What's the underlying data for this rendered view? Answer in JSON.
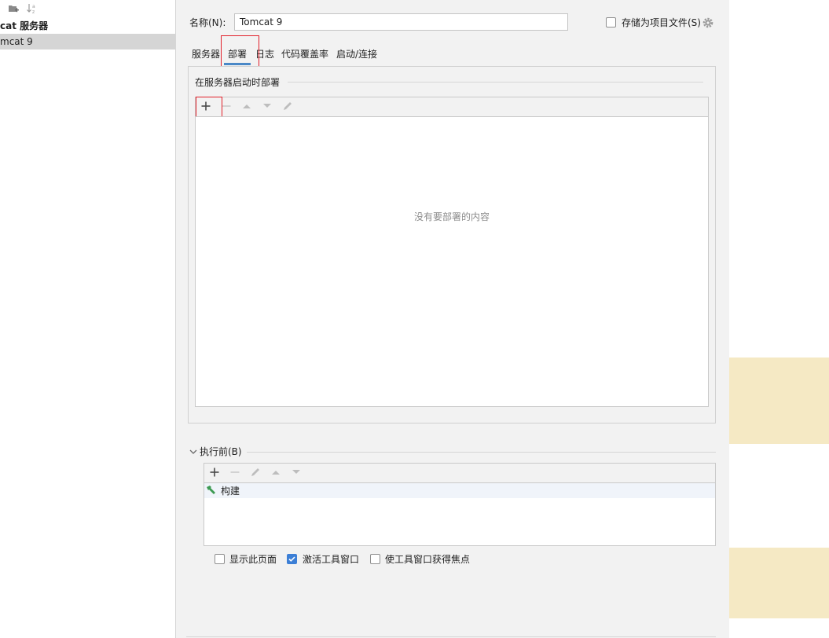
{
  "tree": {
    "group_label": "cat 服务器",
    "config_label": "mcat 9"
  },
  "name": {
    "label": "名称(N):",
    "value": "Tomcat 9"
  },
  "store_as_project": {
    "label": "存储为项目文件(S)",
    "checked": false
  },
  "tabs": [
    {
      "label": "服务器",
      "active": false
    },
    {
      "label": "部署",
      "active": true
    },
    {
      "label": "日志",
      "active": false
    },
    {
      "label": "代码覆盖率",
      "active": false
    },
    {
      "label": "启动/连接",
      "active": false
    }
  ],
  "deploy": {
    "section_title": "在服务器启动时部署",
    "empty_text": "没有要部署的内容",
    "toolbar_icons": [
      "add-icon",
      "remove-icon",
      "move-up-icon",
      "move-down-icon",
      "edit-icon"
    ]
  },
  "before_launch": {
    "title": "执行前(B)",
    "toolbar_icons": [
      "add-icon",
      "remove-icon",
      "edit-icon",
      "move-up-icon",
      "move-down-icon"
    ],
    "items": [
      {
        "label": "构建",
        "icon": "hammer-icon"
      }
    ]
  },
  "options": [
    {
      "label": "显示此页面",
      "checked": false
    },
    {
      "label": "激活工具窗口",
      "checked": true
    },
    {
      "label": "使工具窗口获得焦点",
      "checked": false
    }
  ],
  "colors": {
    "accent": "#4a88c7",
    "highlight_box": "#e2202a",
    "checkbox_checked": "#3c7fd6",
    "build_icon": "#3d9a52",
    "right_band": "#f5e9c4"
  }
}
